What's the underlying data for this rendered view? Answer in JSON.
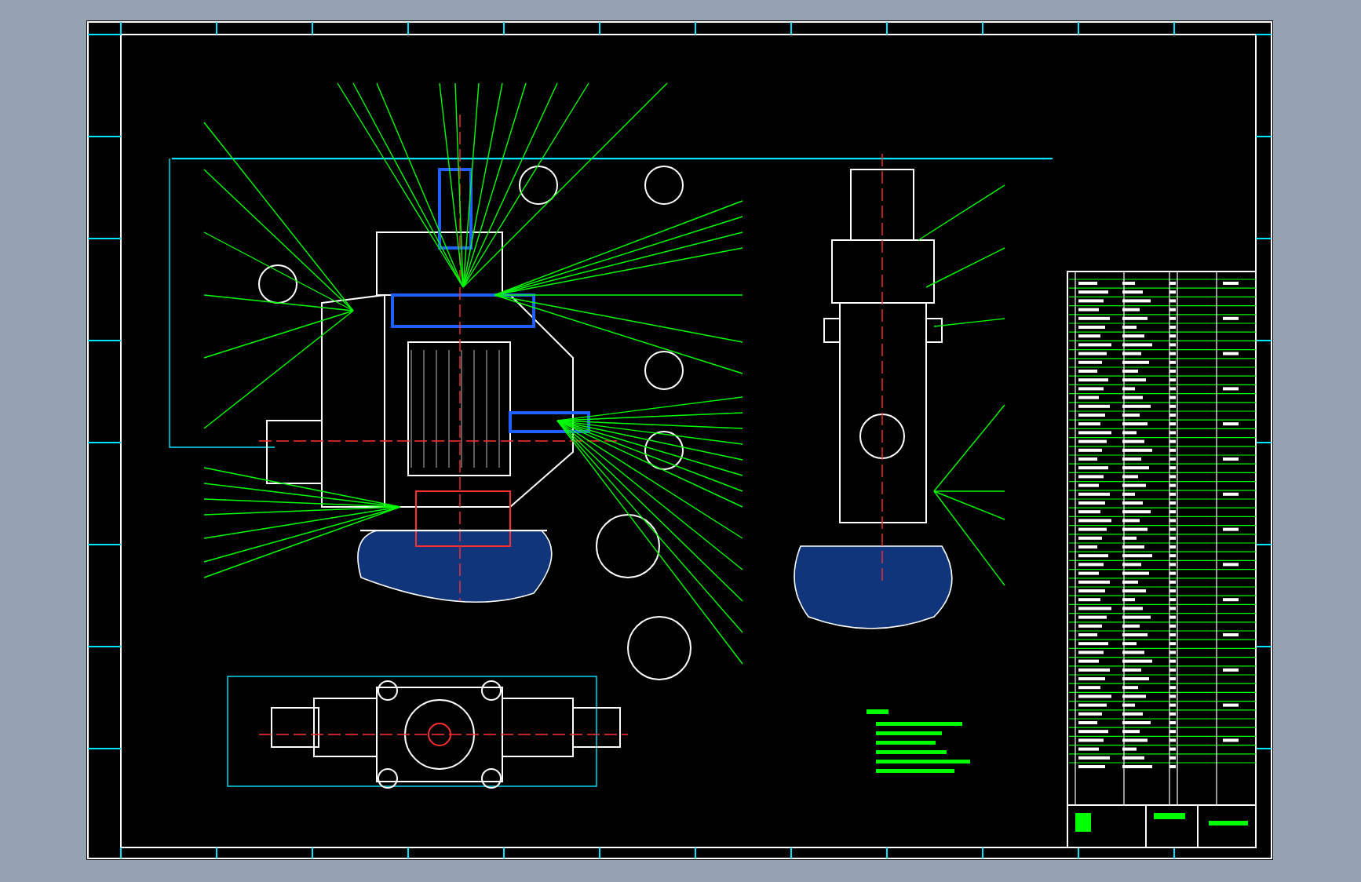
{
  "drawing_sheet": {
    "views": [
      {
        "kind": "section"
      },
      {
        "kind": "side"
      },
      {
        "kind": "plan"
      },
      {
        "kind": "notes"
      },
      {
        "kind": "parts_list"
      }
    ]
  }
}
